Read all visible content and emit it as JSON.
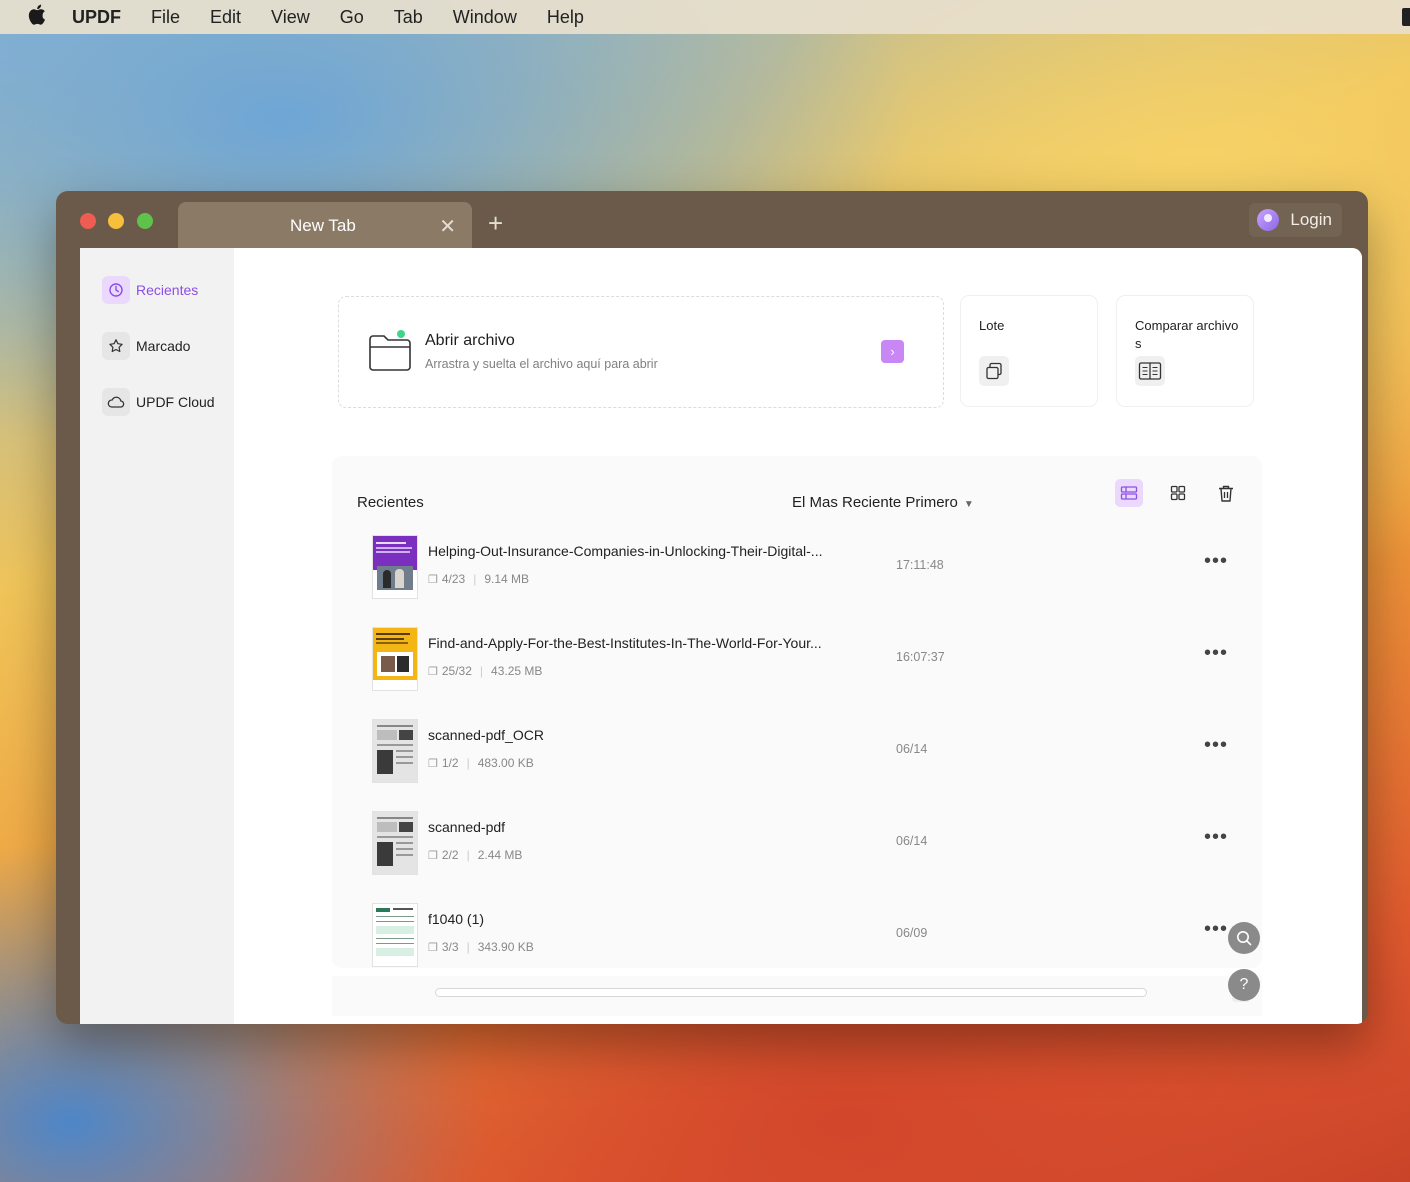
{
  "menubar": {
    "app_name": "UPDF",
    "items": [
      "File",
      "Edit",
      "View",
      "Go",
      "Tab",
      "Window",
      "Help"
    ]
  },
  "window": {
    "tab_title": "New Tab",
    "login_label": "Login"
  },
  "sidebar": {
    "items": [
      {
        "label": "Recientes",
        "icon": "clock-icon"
      },
      {
        "label": "Marcado",
        "icon": "star-icon"
      },
      {
        "label": "UPDF Cloud",
        "icon": "cloud-icon"
      }
    ]
  },
  "open_card": {
    "title": "Abrir archivo",
    "subtitle": "Arrastra y suelta el archivo aquí para abrir"
  },
  "tools": {
    "batch_label": "Lote",
    "compare_label": "Comparar archivos"
  },
  "recent": {
    "title": "Recientes",
    "sort_label": "El Mas Reciente Primero",
    "files": [
      {
        "name": "Helping-Out-Insurance-Companies-in-Unlocking-Their-Digital-...",
        "pages": "4/23",
        "size": "9.14 MB",
        "time": "17:11:48"
      },
      {
        "name": "Find-and-Apply-For-the-Best-Institutes-In-The-World-For-Your...",
        "pages": "25/32",
        "size": "43.25 MB",
        "time": "16:07:37"
      },
      {
        "name": "scanned-pdf_OCR",
        "pages": "1/2",
        "size": "483.00 KB",
        "time": "06/14"
      },
      {
        "name": "scanned-pdf",
        "pages": "2/2",
        "size": "2.44 MB",
        "time": "06/14"
      },
      {
        "name": "f1040 (1)",
        "pages": "3/3",
        "size": "343.90 KB",
        "time": "06/09"
      }
    ]
  },
  "colors": {
    "accent": "#8c4ee6",
    "accent_light": "#ead9fc",
    "arrow_button": "#c887f5"
  }
}
